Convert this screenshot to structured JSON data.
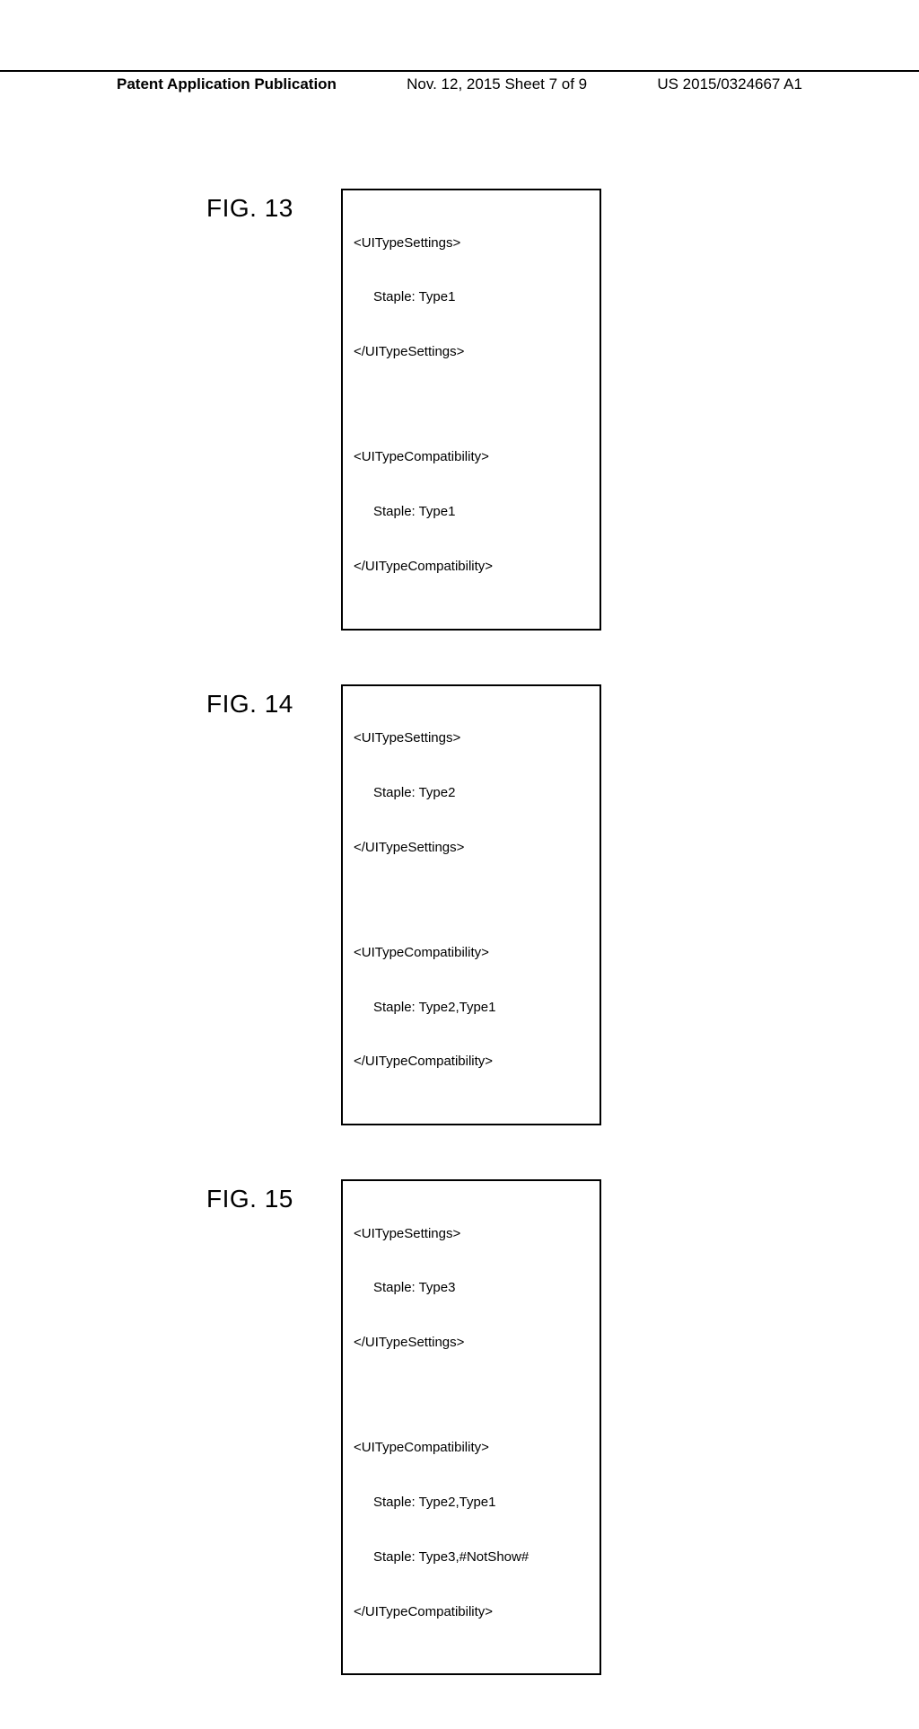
{
  "header": {
    "left": "Patent Application Publication",
    "center": "Nov. 12, 2015  Sheet 7 of 9",
    "right": "US 2015/0324667 A1"
  },
  "figures": [
    {
      "label": "FIG. 13",
      "lines": [
        {
          "text": "<UITypeSettings>",
          "indent": false
        },
        {
          "text": "Staple: Type1",
          "indent": true
        },
        {
          "text": "</UITypeSettings>",
          "indent": false
        },
        {
          "spacer": true
        },
        {
          "text": "<UITypeCompatibility>",
          "indent": false
        },
        {
          "text": "Staple: Type1",
          "indent": true
        },
        {
          "text": "</UITypeCompatibility>",
          "indent": false
        }
      ]
    },
    {
      "label": "FIG. 14",
      "lines": [
        {
          "text": "<UITypeSettings>",
          "indent": false
        },
        {
          "text": "Staple: Type2",
          "indent": true
        },
        {
          "text": "</UITypeSettings>",
          "indent": false
        },
        {
          "spacer": true
        },
        {
          "text": "<UITypeCompatibility>",
          "indent": false
        },
        {
          "text": "Staple: Type2,Type1",
          "indent": true
        },
        {
          "text": "</UITypeCompatibility>",
          "indent": false
        }
      ]
    },
    {
      "label": "FIG. 15",
      "lines": [
        {
          "text": "<UITypeSettings>",
          "indent": false
        },
        {
          "text": "Staple: Type3",
          "indent": true
        },
        {
          "text": "</UITypeSettings>",
          "indent": false
        },
        {
          "spacer": true
        },
        {
          "text": "<UITypeCompatibility>",
          "indent": false
        },
        {
          "text": "Staple: Type2,Type1",
          "indent": true
        },
        {
          "text": "Staple: Type3,#NotShow#",
          "indent": true
        },
        {
          "text": "</UITypeCompatibility>",
          "indent": false
        }
      ]
    }
  ]
}
